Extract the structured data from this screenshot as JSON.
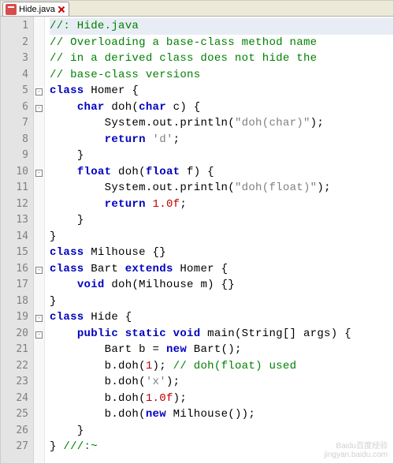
{
  "tab": {
    "filename": "Hide.java"
  },
  "lines": [
    "1",
    "2",
    "3",
    "4",
    "5",
    "6",
    "7",
    "8",
    "9",
    "10",
    "11",
    "12",
    "13",
    "14",
    "15",
    "16",
    "17",
    "18",
    "19",
    "20",
    "21",
    "22",
    "23",
    "24",
    "25",
    "26",
    "27"
  ],
  "fold": {
    "l5": "-",
    "l6": "-",
    "l10": "-",
    "l16": "-",
    "l19": "-",
    "l20": "-"
  },
  "code": {
    "l1": {
      "a": "//: Hide.java"
    },
    "l2": {
      "a": "// Overloading a base-class method name"
    },
    "l3": {
      "a": "// in a derived class does not hide the"
    },
    "l4": {
      "a": "// base-class versions"
    },
    "l5": {
      "kw": "class",
      "name": " Homer {"
    },
    "l6": {
      "kw": "char",
      "a": " doh(",
      "kw2": "char",
      "b": " c) {"
    },
    "l7": {
      "a": "System.out.println(",
      "str": "\"doh(char)\"",
      "b": ");"
    },
    "l8": {
      "kw": "return",
      "a": " ",
      "str": "'d'",
      "b": ";"
    },
    "l9": {
      "a": "}"
    },
    "l10": {
      "kw": "float",
      "a": " doh(",
      "kw2": "float",
      "b": " f) {"
    },
    "l11": {
      "a": "System.out.println(",
      "str": "\"doh(float)\"",
      "b": ");"
    },
    "l12": {
      "kw": "return",
      "a": " ",
      "num": "1.0f",
      "b": ";"
    },
    "l13": {
      "a": "}"
    },
    "l14": {
      "a": "}"
    },
    "l15": {
      "kw": "class",
      "a": " Milhouse {}"
    },
    "l16": {
      "kw": "class",
      "a": " Bart ",
      "kw2": "extends",
      "b": " Homer {"
    },
    "l17": {
      "kw": "void",
      "a": " doh(Milhouse m) {}"
    },
    "l18": {
      "a": "}"
    },
    "l19": {
      "kw": "class",
      "a": " Hide {"
    },
    "l20": {
      "kw": "public static void",
      "a": " main(String[] args) {"
    },
    "l21": {
      "a": "Bart b = ",
      "kw": "new",
      "b": " Bart();"
    },
    "l22": {
      "a": "b.doh(",
      "num": "1",
      "b": "); ",
      "cm": "// doh(float) used"
    },
    "l23": {
      "a": "b.doh(",
      "str": "'x'",
      "b": ");"
    },
    "l24": {
      "a": "b.doh(",
      "num": "1.0f",
      "b": ");"
    },
    "l25": {
      "a": "b.doh(",
      "kw": "new",
      "b": " Milhouse());"
    },
    "l26": {
      "a": "}"
    },
    "l27": {
      "a": "} ",
      "cm": "///:~"
    }
  },
  "watermark": {
    "line1": "Baidu百度经验",
    "line2": "jingyan.baidu.com"
  }
}
